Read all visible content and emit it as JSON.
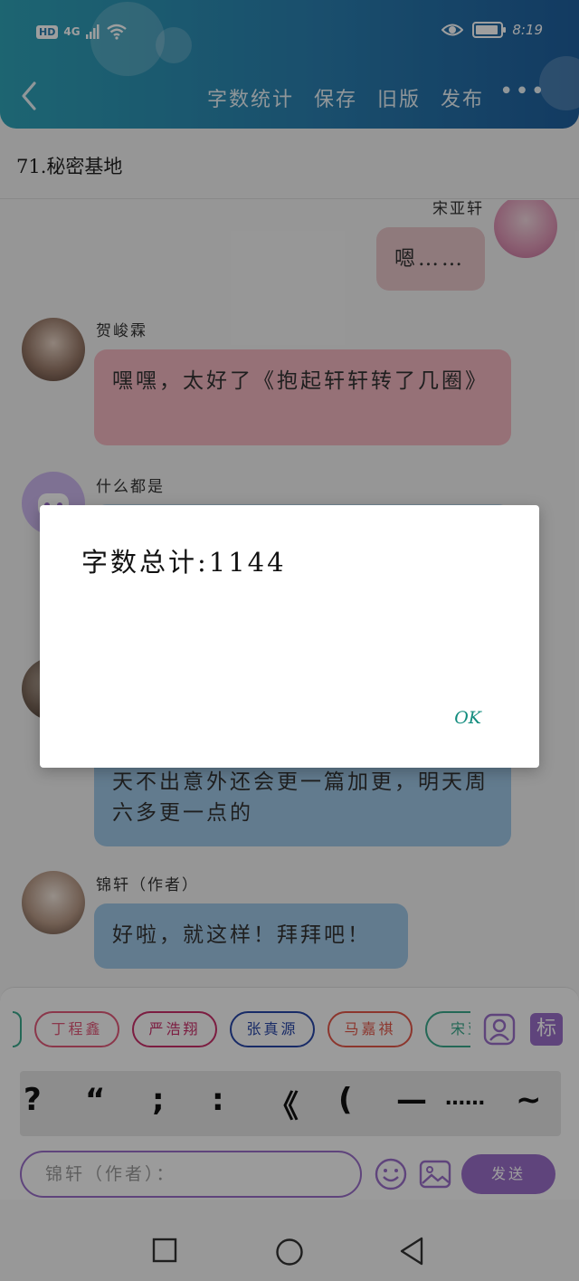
{
  "status_bar": {
    "hd": "HD",
    "network": "4G",
    "time": "8:19"
  },
  "nav": {
    "back_icon": "chevron-left-icon",
    "actions": [
      "字数统计",
      "保存",
      "旧版",
      "发布"
    ],
    "more": "•••"
  },
  "chapter": {
    "title": "71.秘密基地"
  },
  "messages": [
    {
      "sender": "宋亚轩",
      "text": "嗯……",
      "side": "right",
      "color": "#e7c5c9"
    },
    {
      "sender": "贺峻霖",
      "text": "嘿嘿，太好了《抱起轩轩转了几圈》",
      "side": "left",
      "color": "#f2b7c0"
    },
    {
      "sender": "什么都是",
      "text": "",
      "side": "left",
      "color": "#b9d7ee"
    },
    {
      "sender": "",
      "text": "天不出意外还会更一篇加更，明天周六多更一点的",
      "side": "left",
      "color": "#9fc7e6"
    },
    {
      "sender": "锦轩（作者）",
      "text": "好啦，就这样！拜拜吧！",
      "side": "left",
      "color": "#9fc7e6"
    }
  ],
  "character_chips": [
    {
      "label": "丁程鑫",
      "color": "#e05a7a"
    },
    {
      "label": "严浩翔",
      "color": "#c8306a"
    },
    {
      "label": "张真源",
      "color": "#2846a6"
    },
    {
      "label": "马嘉祺",
      "color": "#e2584a"
    },
    {
      "label": "宋亚",
      "color": "#3aa88c"
    }
  ],
  "tag_button": "标",
  "punctuation": [
    "?",
    "“",
    ";",
    ":",
    "《",
    "(",
    "—",
    "……",
    "~"
  ],
  "input": {
    "placeholder": "锦轩（作者）："
  },
  "send_button": "发送",
  "dialog": {
    "message": "字数总计:1144",
    "ok_label": "OK"
  },
  "colors": {
    "header_gradient_start": "#2fa3b7",
    "header_gradient_end": "#1f5f9e",
    "accent_purple": "#9a6fc9",
    "ok_teal": "#128c7e"
  }
}
